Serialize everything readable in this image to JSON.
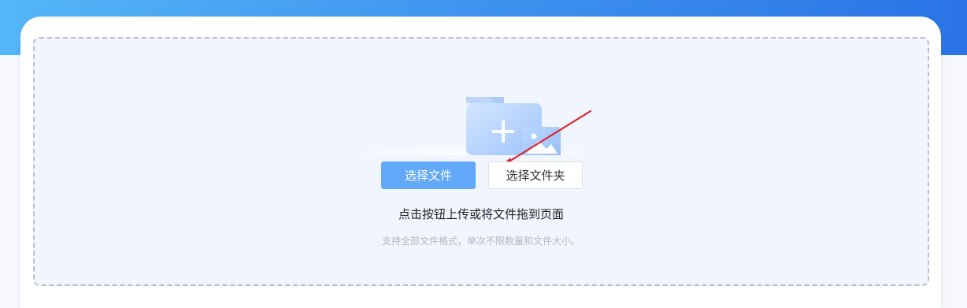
{
  "upload": {
    "select_file_label": "选择文件",
    "select_folder_label": "选择文件夹",
    "hint": "点击按钮上传或将文件拖到页面",
    "subhint": "支持全部文件格式，单次不限数量和文件大小。"
  },
  "icons": {
    "folder": "folder-add-icon",
    "image": "image-icon",
    "annotation": "red-arrow-annotation"
  },
  "colors": {
    "banner_start": "#54b6f7",
    "banner_end": "#2a74e6",
    "primary_button": "#62a9f9",
    "dropzone_bg": "#f0f5fe",
    "arrow": "#e0202a"
  }
}
